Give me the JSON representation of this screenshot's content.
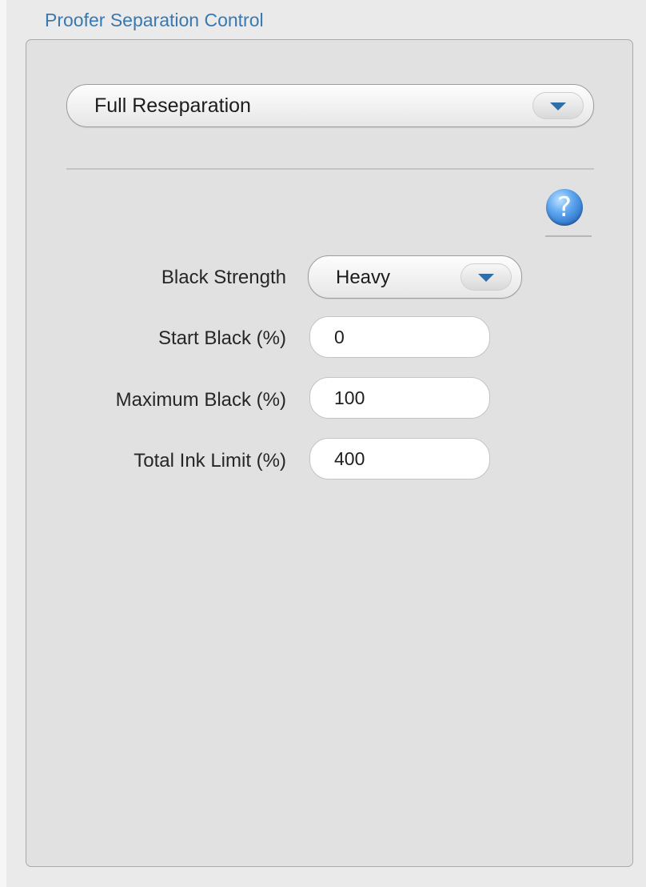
{
  "panel": {
    "title": "Proofer Separation Control"
  },
  "separation_mode": {
    "selected": "Full Reseparation"
  },
  "help": {
    "glyph": "?",
    "icon": "help-question-icon"
  },
  "fields": {
    "black_strength": {
      "label": "Black Strength",
      "selected": "Heavy"
    },
    "start_black": {
      "label": "Start Black (%)",
      "value": "0"
    },
    "maximum_black": {
      "label": "Maximum Black (%)",
      "value": "100"
    },
    "total_ink_limit": {
      "label": "Total Ink Limit (%)",
      "value": "400"
    }
  },
  "colors": {
    "title_blue": "#3a78b0",
    "arrow_blue": "#2f6ea6",
    "help_blue": "#2a6fc6",
    "panel_bg": "#e1e1e1"
  }
}
